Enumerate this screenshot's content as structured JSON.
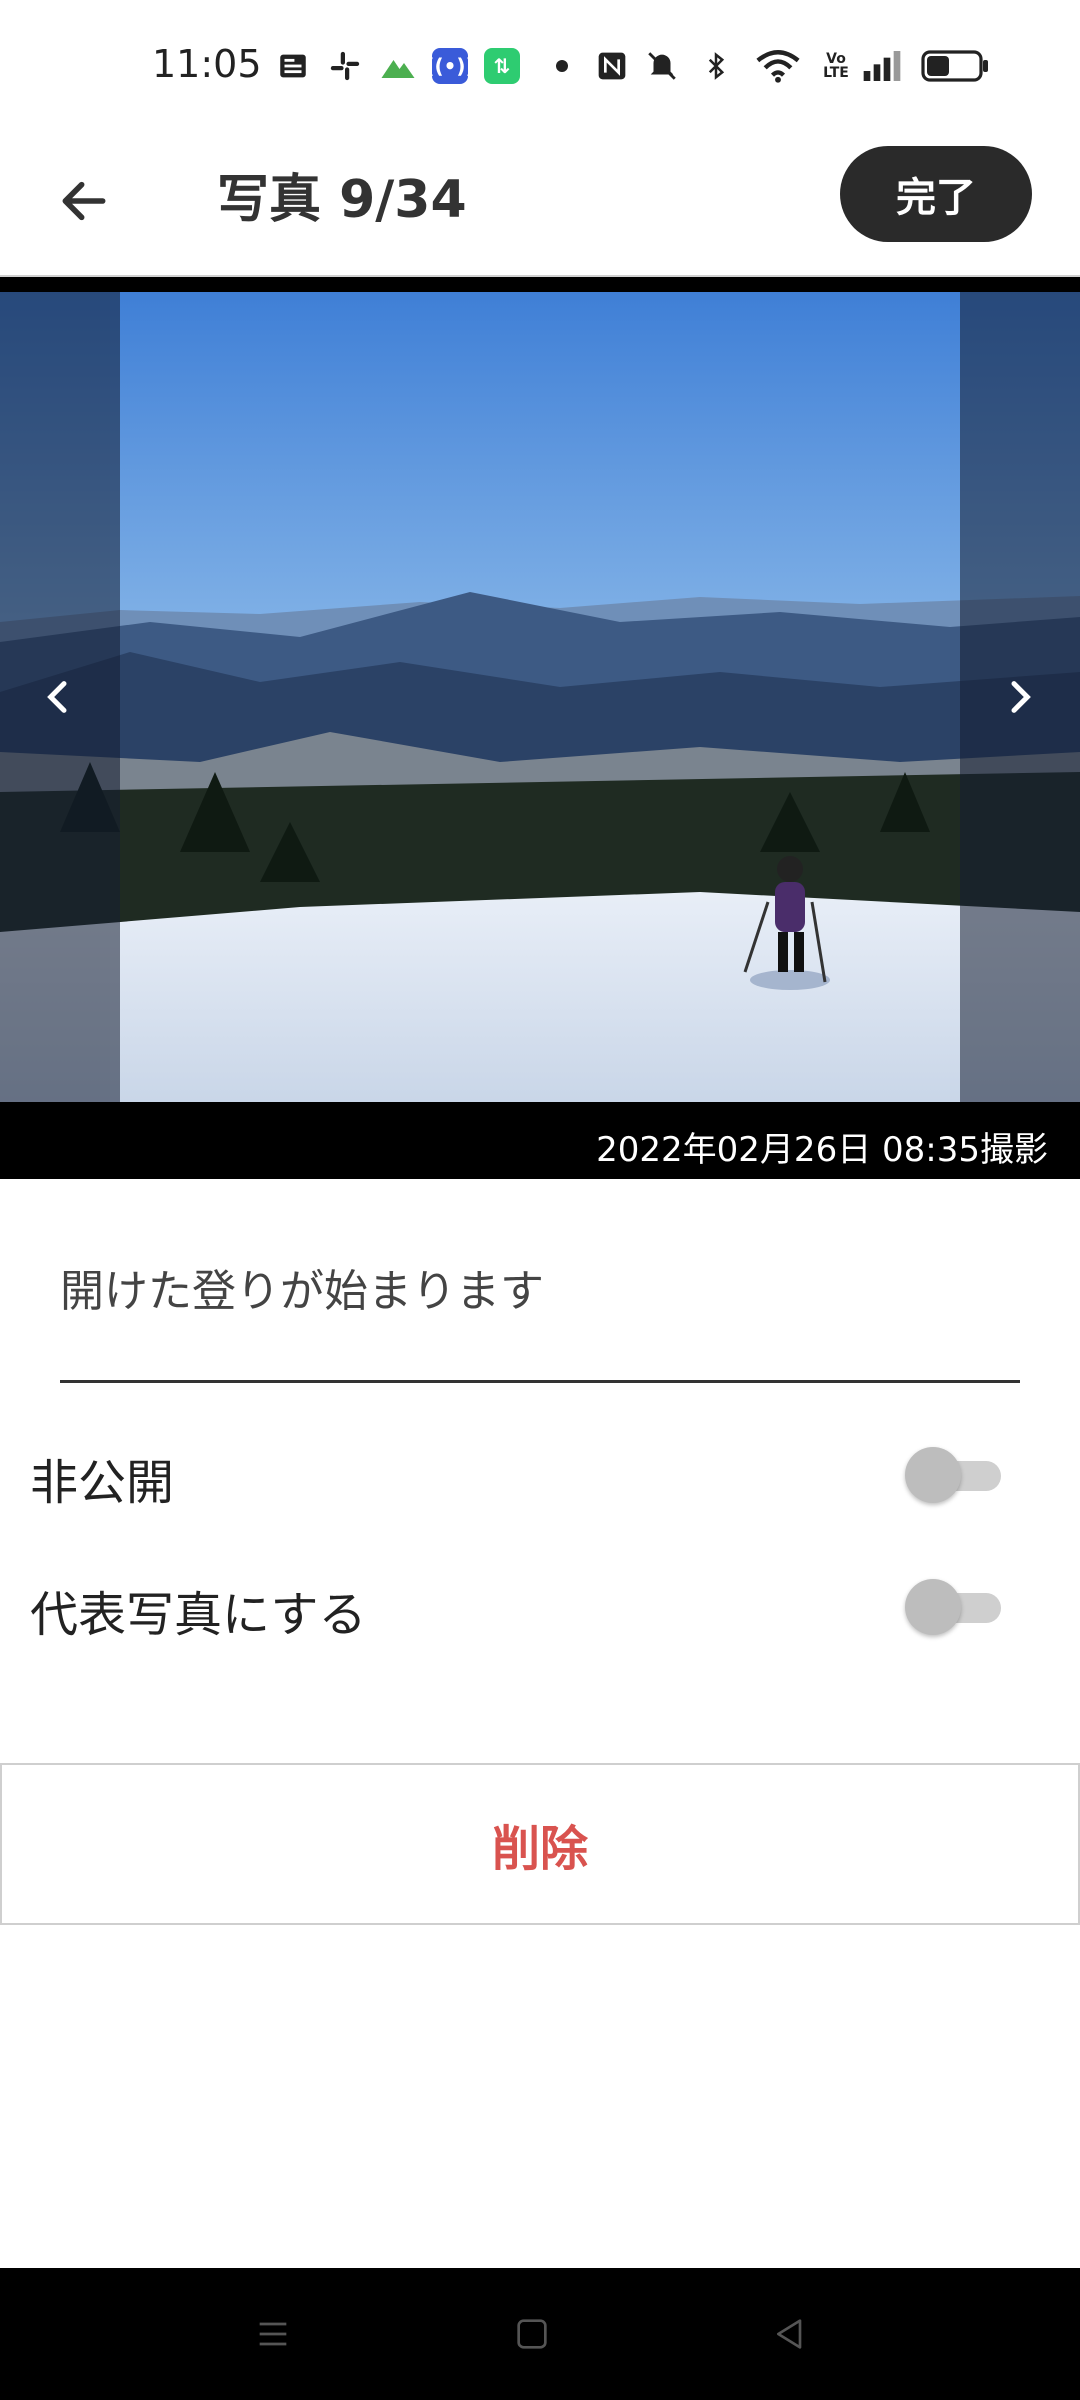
{
  "status_bar": {
    "time": "11:05",
    "icons": [
      "news-icon",
      "slack-icon",
      "mountain-app-icon",
      "broadcast-icon",
      "transfer-icon",
      "dot-icon",
      "nfc-icon",
      "muted-bell-icon",
      "bluetooth-icon",
      "wifi-icon",
      "volte-icon",
      "signal-icon",
      "battery-icon"
    ]
  },
  "header": {
    "title": "写真 9/34",
    "done_label": "完了"
  },
  "photo": {
    "taken_at": "2022年02月26日 08:35撮影"
  },
  "caption": {
    "value": "開けた登りが始まります"
  },
  "settings": [
    {
      "label": "非公開",
      "enabled": false
    },
    {
      "label": "代表写真にする",
      "enabled": false
    }
  ],
  "actions": {
    "delete_label": "削除",
    "delete_color": "#d9534f"
  },
  "system_nav": [
    "menu-icon",
    "home-icon",
    "back-icon"
  ]
}
